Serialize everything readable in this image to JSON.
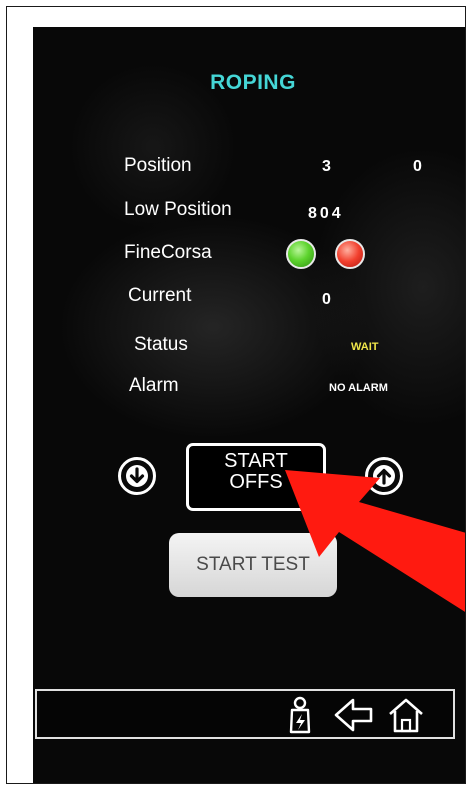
{
  "screen": {
    "title": "ROPING",
    "rows": {
      "position": {
        "label": "Position",
        "value_1": "3",
        "value_2": "0"
      },
      "low_position": {
        "label": "Low Position",
        "value": "804"
      },
      "finecorsa": {
        "label": "FineCorsa",
        "led_1_color": "#5ed42e",
        "led_2_color": "#f2402e"
      },
      "current": {
        "label": "Current",
        "value": "0"
      },
      "status": {
        "label": "Status",
        "value": "WAIT",
        "value_color": "#f0e64a"
      },
      "alarm": {
        "label": "Alarm",
        "value": "NO ALARM"
      }
    },
    "buttons": {
      "down_icon": "arrow-down-icon",
      "up_icon": "arrow-up-icon",
      "start_offset_line1": "START",
      "start_offset_line2": "OFFS",
      "start_test": "START TEST"
    },
    "nav": {
      "icons": [
        "user-badge-icon",
        "back-arrow-icon",
        "home-icon"
      ]
    },
    "colors": {
      "title": "#45d6d6",
      "annotation_arrow": "#ff1a10"
    }
  }
}
